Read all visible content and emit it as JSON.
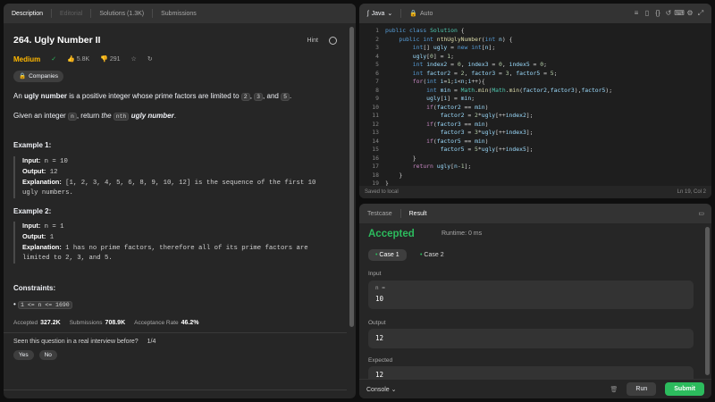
{
  "left": {
    "tabs": [
      "Description",
      "Editorial",
      "Solutions (1.3K)",
      "Submissions"
    ],
    "title": "264. Ugly Number II",
    "hint": "Hint",
    "difficulty": "Medium",
    "likes": "5.8K",
    "dislikes": "291",
    "companies": "Companies",
    "desc1_a": "An ",
    "desc1_b": "ugly number",
    "desc1_c": " is a positive integer whose prime factors are limited to ",
    "desc1_f2": "2",
    "desc1_f3": "3",
    "desc1_and": ", and ",
    "desc1_f5": "5",
    "desc1_end": ".",
    "desc2_a": "Given an integer ",
    "desc2_n": "n",
    "desc2_b": ", return ",
    "desc2_c": "the ",
    "desc2_nth": "nth",
    "desc2_d": " ugly number",
    "desc2_end": ".",
    "ex1_h": "Example 1:",
    "ex1_input_l": "Input:",
    "ex1_input": " n = 10",
    "ex1_output_l": "Output:",
    "ex1_output": " 12",
    "ex1_expl_l": "Explanation:",
    "ex1_expl": " [1, 2, 3, 4, 5, 6, 8, 9, 10, 12] is the sequence of the first 10",
    "ex1_expl2": "ugly numbers.",
    "ex2_h": "Example 2:",
    "ex2_input_l": "Input:",
    "ex2_input": " n = 1",
    "ex2_output_l": "Output:",
    "ex2_output": " 1",
    "ex2_expl_l": "Explanation:",
    "ex2_expl": " 1 has no prime factors, therefore all of its prime factors are",
    "ex2_expl2": "limited to 2, 3, and 5.",
    "constraints_h": "Constraints:",
    "constraint1": "1 <= n <= 1690",
    "accepted_l": "Accepted",
    "accepted_v": "327.2K",
    "submissions_l": "Submissions",
    "submissions_v": "708.9K",
    "rate_l": "Acceptance Rate",
    "rate_v": "46.2%",
    "interview_q": "Seen this question in a real interview before?",
    "interview_count": "1/4",
    "yes": "Yes",
    "no": "No"
  },
  "editor": {
    "language": "Java",
    "mode": "Auto",
    "saved": "Saved to local",
    "cursor": "Ln 19, Col 2",
    "line_numbers": [
      "1",
      "2",
      "3",
      "4",
      "5",
      "6",
      "7",
      "8",
      "9",
      "10",
      "11",
      "12",
      "13",
      "14",
      "15",
      "16",
      "17",
      "18",
      "19"
    ]
  },
  "result": {
    "tabs": [
      "Testcase",
      "Result"
    ],
    "status": "Accepted",
    "runtime": "Runtime: 0 ms",
    "case1": "Case 1",
    "case2": "Case 2",
    "input_l": "Input",
    "input_var": "n =",
    "input_v": "10",
    "output_l": "Output",
    "output_v": "12",
    "expected_l": "Expected",
    "expected_v": "12",
    "console": "Console",
    "run": "Run",
    "submit": "Submit"
  },
  "colors": {
    "accent_green": "#2cbb5d",
    "medium": "#ffb800"
  }
}
